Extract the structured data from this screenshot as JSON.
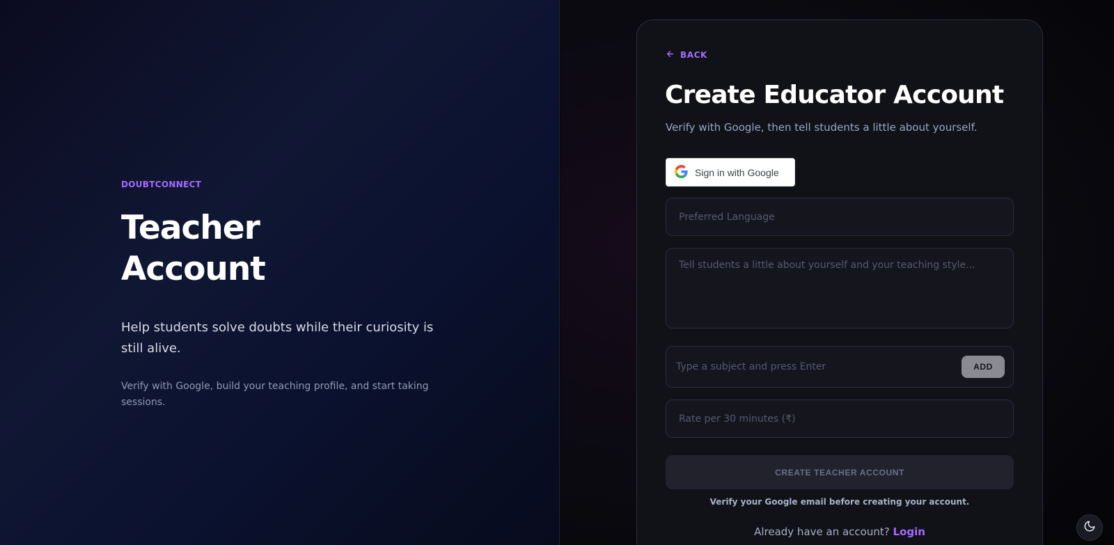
{
  "hero": {
    "brand": "DOUBTCONNECT",
    "title": "Teacher Account",
    "lead": "Help students solve doubts while their curiosity is still alive.",
    "sub": "Verify with Google, build your teaching profile, and start taking sessions."
  },
  "form": {
    "back_label": "BACK",
    "title": "Create Educator Account",
    "subtitle": "Verify with Google, then tell students a little about yourself.",
    "google_label": "Sign in with Google",
    "language_placeholder": "Preferred Language",
    "bio_placeholder": "Tell students a little about yourself and your teaching style...",
    "subject_placeholder": "Type a subject and press Enter",
    "add_label": "ADD",
    "rate_placeholder": "Rate per 30 minutes (₹)",
    "create_label": "CREATE TEACHER ACCOUNT",
    "verify_note": "Verify your Google email before creating your account.",
    "login_prompt": "Already have an account?",
    "login_label": "Login"
  },
  "icons": {
    "back": "arrow-left-icon",
    "google": "google-icon",
    "theme": "moon-icon"
  },
  "colors": {
    "accent": "#a46bff",
    "card_bg": "#111118",
    "hero_bg": "#101733"
  }
}
